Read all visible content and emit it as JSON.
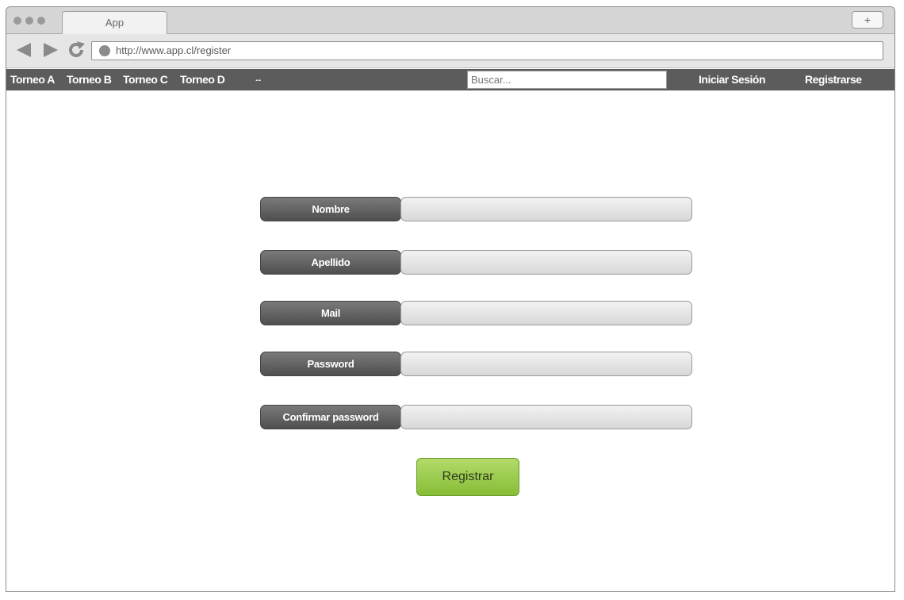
{
  "browser": {
    "tab_title": "App",
    "new_tab_label": "+",
    "url": "http://www.app.cl/register"
  },
  "menubar": {
    "items": [
      "Torneo A",
      "Torneo B",
      "Torneo C",
      "Torneo D",
      "..."
    ],
    "search_placeholder": "Buscar...",
    "login_label": "Iniciar Sesión",
    "register_label": "Registrarse"
  },
  "form": {
    "fields": [
      {
        "label": "Nombre",
        "value": ""
      },
      {
        "label": "Apellido",
        "value": ""
      },
      {
        "label": "Mail",
        "value": ""
      },
      {
        "label": "Password",
        "value": ""
      },
      {
        "label": "Confirmar password",
        "value": ""
      }
    ],
    "submit_label": "Registrar"
  },
  "colors": {
    "menubar": "#5c5c5c",
    "submit_button": "#9acb4d"
  },
  "icons": [
    "back-arrow-icon",
    "forward-arrow-icon",
    "reload-icon",
    "url-status-icon"
  ]
}
